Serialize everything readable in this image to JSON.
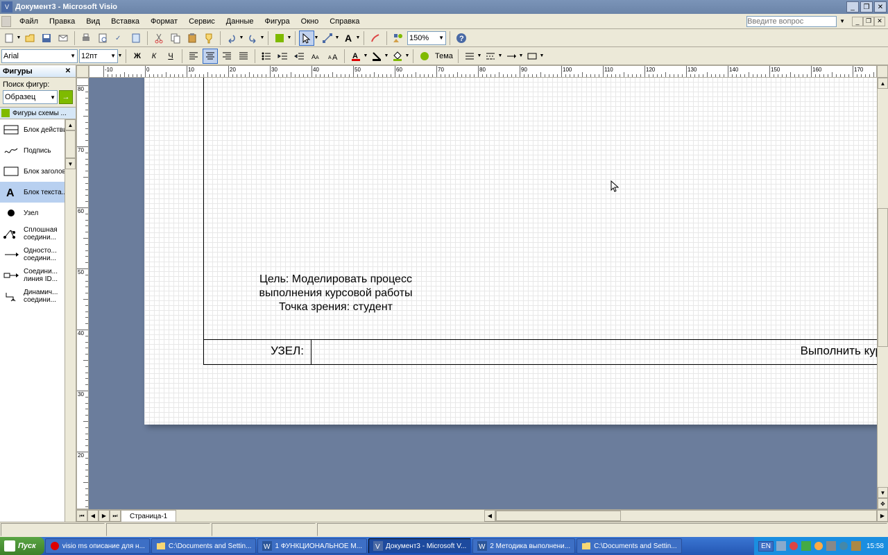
{
  "titlebar": {
    "title": "Документ3 - Microsoft Visio"
  },
  "menu": {
    "items": [
      "Файл",
      "Правка",
      "Вид",
      "Вставка",
      "Формат",
      "Сервис",
      "Данные",
      "Фигура",
      "Окно",
      "Справка"
    ],
    "ask_placeholder": "Введите вопрос"
  },
  "toolbar": {
    "zoom": "150%"
  },
  "format": {
    "font": "Arial",
    "size": "12пт",
    "theme_label": "Тема"
  },
  "shapes": {
    "title": "Фигуры",
    "search_label": "Поиск фигур:",
    "search_value": "Образец",
    "stencil": "Фигуры схемы ...",
    "items": [
      {
        "label": "Блок действия"
      },
      {
        "label": "Подпись"
      },
      {
        "label": "Блок заголовка"
      },
      {
        "label": "Блок текста..."
      },
      {
        "label": "Узел"
      },
      {
        "label": "Сплошная соедини..."
      },
      {
        "label": "Односто... соедини..."
      },
      {
        "label": "Соедини... линия ID..."
      },
      {
        "label": "Динамич... соедини..."
      }
    ]
  },
  "canvas": {
    "text_line1": "Цель: Моделировать процесс",
    "text_line2": "выполнения курсовой работы",
    "text_line3": "Точка зрения: студент",
    "node_label": "УЗЕЛ:",
    "footer_title": "Выполнить курсовую работу"
  },
  "pagetabs": {
    "page1": "Страница-1"
  },
  "taskbar": {
    "start": "Пуск",
    "buttons": [
      "visio ms описание для н...",
      "C:\\Documents and Settin...",
      "1 ФУНКЦИОНАЛЬНОЕ М...",
      "Документ3 - Microsoft V...",
      "2 Методика выполнени...",
      "C:\\Documents and Settin..."
    ],
    "lang": "EN",
    "clock": "15:58"
  },
  "ruler": {
    "h_labels": [
      "-10",
      "0",
      "10",
      "20",
      "30",
      "40",
      "50",
      "60",
      "70",
      "80",
      "90",
      "100",
      "110",
      "120",
      "130",
      "140",
      "150",
      "160",
      "170"
    ],
    "v_labels": [
      "80",
      "70",
      "60",
      "50",
      "40",
      "30",
      "20"
    ]
  }
}
